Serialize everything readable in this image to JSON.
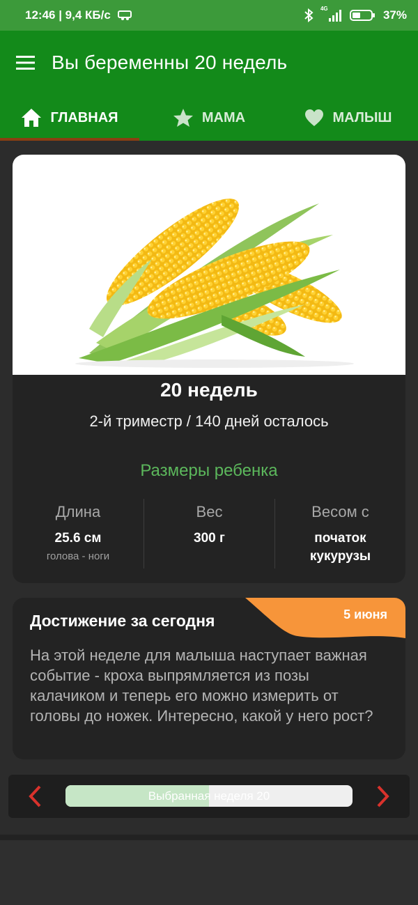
{
  "status_bar": {
    "time_speed": "12:46 | 9,4 КБ/с",
    "network_label": "4G",
    "battery": "37%"
  },
  "app_bar": {
    "title": "Вы беременны 20 недель"
  },
  "tabs": [
    {
      "label": "ГЛАВНАЯ",
      "icon": "home-icon",
      "active": true
    },
    {
      "label": "МАМА",
      "icon": "star-icon",
      "active": false
    },
    {
      "label": "МАЛЫШ",
      "icon": "heart-icon",
      "active": false
    }
  ],
  "week_card": {
    "image": "corn-image",
    "week": "20 недель",
    "subtitle": "2-й триместр / 140 дней осталось",
    "sizes_title": "Размеры ребенка",
    "stats": [
      {
        "label": "Длина",
        "value": "25.6 см",
        "note": "голова - ноги"
      },
      {
        "label": "Вес",
        "value": "300 г",
        "note": ""
      },
      {
        "label": "Весом с",
        "value": "початок кукурузы",
        "note": ""
      }
    ]
  },
  "achievement": {
    "title": "Достижение за сегодня",
    "date_badge": "5 июня",
    "text": "На этой неделе для малыша наступает важная событие - кроха выпрямляется из позы калачиком и теперь его можно измерить от головы до ножек. Интересно, какой у него рост?"
  },
  "week_selector": {
    "label": "Выбранная неделя 20",
    "progress": 0.5
  },
  "colors": {
    "status_bar": "#3c9a3a",
    "app_bar": "#138a1a",
    "tab_indicator": "#8a3f12",
    "card": "#232323",
    "accent_green": "#5cb85c",
    "badge_orange": "#f7953a",
    "arrow_red": "#d9322c"
  }
}
